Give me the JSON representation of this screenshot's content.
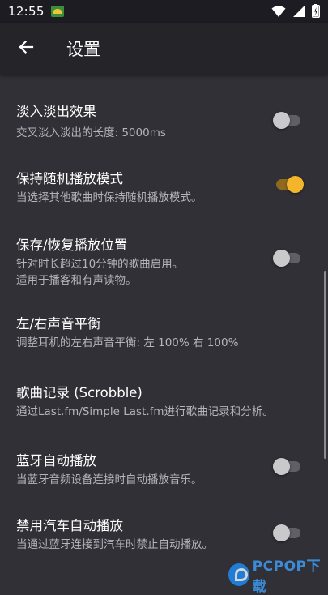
{
  "status_bar": {
    "time": "12:55",
    "icons": [
      "wifi-icon",
      "signal-icon",
      "battery-charging-icon"
    ]
  },
  "app_bar": {
    "back_icon": "arrow-left-icon",
    "title": "设置"
  },
  "settings": [
    {
      "title": "淡入淡出效果",
      "summary": [
        "交叉淡入淡出的长度: 5000ms"
      ],
      "has_switch": true,
      "switch_on": false
    },
    {
      "title": "保持随机播放模式",
      "summary": [
        "当选择其他歌曲时保持随机播放模式。"
      ],
      "has_switch": true,
      "switch_on": true
    },
    {
      "title": "保存/恢复播放位置",
      "summary": [
        "针对时长超过10分钟的歌曲启用。",
        "适用于播客和有声读物。"
      ],
      "has_switch": true,
      "switch_on": false
    },
    {
      "title": "左/右声音平衡",
      "summary": [
        "调整耳机的左右声音平衡: 左 100% 右 100%"
      ],
      "has_switch": false
    },
    {
      "title": "歌曲记录 (Scrobble)",
      "summary": [
        "通过Last.fm/Simple Last.fm进行歌曲记录和分析。"
      ],
      "has_switch": false
    },
    {
      "title": "蓝牙自动播放",
      "summary": [
        "当蓝牙音频设备连接时自动播放音乐。"
      ],
      "has_switch": true,
      "switch_on": false
    },
    {
      "title": "禁用汽车自动播放",
      "summary": [
        "当通过蓝牙连接到汽车时禁止自动播放。"
      ],
      "has_switch": true,
      "switch_on": false
    }
  ],
  "colors": {
    "background": "#303036",
    "app_bar": "#242429",
    "status_bar": "#1c1c22",
    "accent": "#f5b52a",
    "summary_text": "#b4b4ba"
  },
  "watermark": {
    "text": "PCPOP下载"
  }
}
